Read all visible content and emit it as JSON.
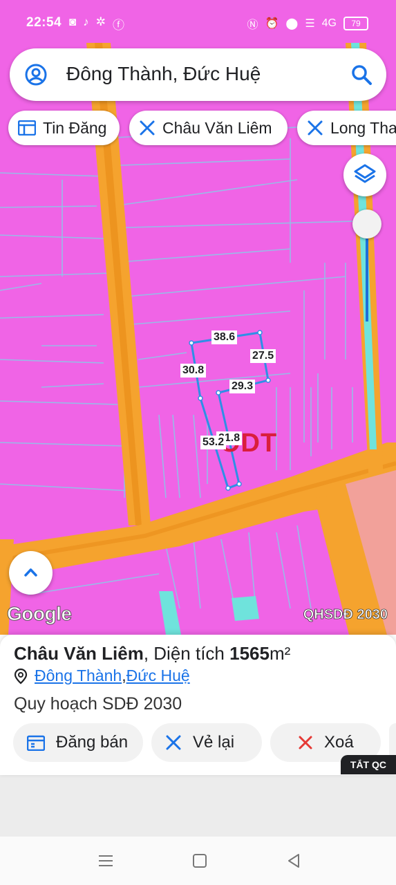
{
  "status_bar": {
    "time": "22:54",
    "battery": "79",
    "network": "4G"
  },
  "search": {
    "query": "Đông Thành, Đức Huệ"
  },
  "chips": [
    {
      "label": "Tin Đăng",
      "icon": "listing-icon"
    },
    {
      "label": "Châu Văn Liêm",
      "icon": "ruler-icon"
    },
    {
      "label": "Long Tha",
      "icon": "ruler-icon"
    }
  ],
  "map": {
    "zone_code": "ODT",
    "edge_labels": [
      "38.6",
      "27.5",
      "30.8",
      "29.3",
      "53.2",
      "21.8"
    ],
    "attribution": "Google",
    "layer_name": "QHSDĐ 2030",
    "colors": {
      "residential": "#f064e6",
      "road": "#f5a32e",
      "boundary": "#2e8fe6"
    }
  },
  "sheet": {
    "title_name": "Châu Văn Liêm",
    "title_mid": ", Diện tích ",
    "area_value": "1565",
    "area_unit": "m²",
    "location_ward": "Đông Thành",
    "location_sep": ", ",
    "location_district": "Đức Huệ",
    "plan_label": "Quy hoạch SDĐ 2030",
    "actions": [
      {
        "label": "Đăng bán",
        "icon": "calendar-icon"
      },
      {
        "label": "Vẻ lại",
        "icon": "redraw-icon"
      },
      {
        "label": "Xoá",
        "icon": "close-icon"
      }
    ],
    "ad_label": "TẮT QC"
  }
}
